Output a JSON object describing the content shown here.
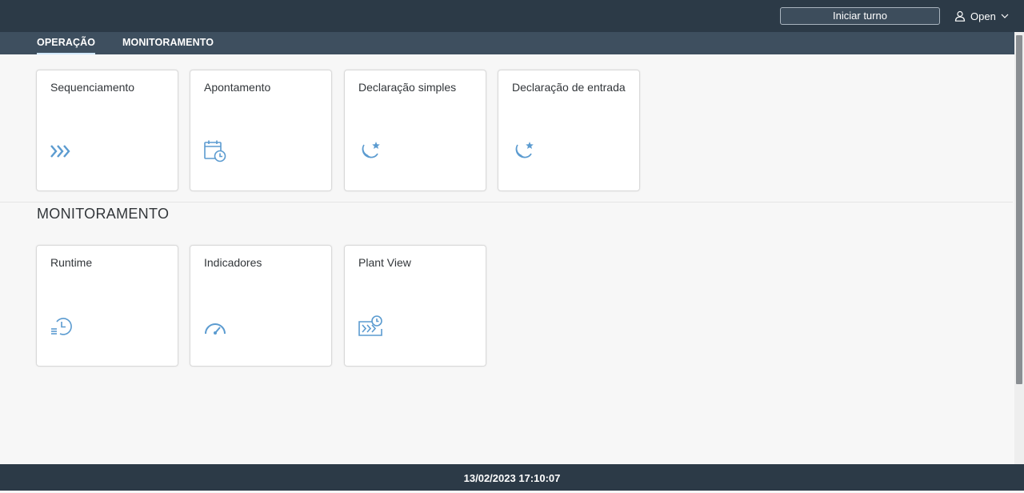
{
  "header": {
    "shift_button_label": "Iniciar turno",
    "user_label": "Open"
  },
  "tabs": [
    {
      "label": "OPERAÇÃO",
      "active": true
    },
    {
      "label": "MONITORAMENTO",
      "active": false
    }
  ],
  "operacao": {
    "tiles": [
      {
        "title": "Sequenciamento",
        "icon": "chevrons-right-icon"
      },
      {
        "title": "Apontamento",
        "icon": "calendar-clock-icon"
      },
      {
        "title": "Declaração simples",
        "icon": "moon-star-icon"
      },
      {
        "title": "Declaração de entrada",
        "icon": "moon-star-icon"
      }
    ]
  },
  "monitoramento": {
    "title": "MONITORAMENTO",
    "tiles": [
      {
        "title": "Runtime",
        "icon": "history-list-icon"
      },
      {
        "title": "Indicadores",
        "icon": "gauge-icon"
      },
      {
        "title": "Plant View",
        "icon": "plant-view-icon"
      }
    ]
  },
  "footer": {
    "datetime": "13/02/2023 17:10:07"
  },
  "colors": {
    "shellbar": "#2c3a47",
    "tabbar": "#3e4f5f",
    "icon": "#5b9bd0",
    "tab_active_underline": "#d1e8ff"
  }
}
